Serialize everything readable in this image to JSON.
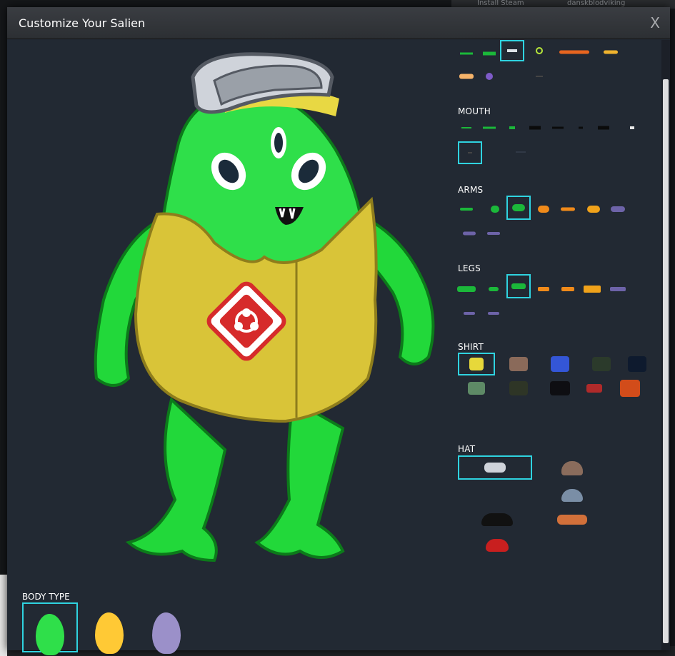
{
  "background": {
    "top_items": [
      "Install Steam",
      "danskblodviking"
    ],
    "bottom_items": [
      "...",
      "..."
    ]
  },
  "dialog": {
    "title": "Customize Your Salien",
    "close_label": "X"
  },
  "sections": {
    "mouth_label": "MOUTH",
    "arms_label": "ARMS",
    "legs_label": "LEGS",
    "shirt_label": "SHIRT",
    "hat_label": "HAT",
    "body_type_label": "BODY TYPE"
  },
  "colors": {
    "accent": "#2fd3e0",
    "panel_bg": "#222933",
    "body_green": "#2fdf4a",
    "body_yellow": "#ffc935",
    "body_purple": "#9b90c9",
    "suit_yellow": "#d9c438",
    "hazard_red": "#d62b2b"
  },
  "selected": {
    "eyes": "goggle-eye",
    "mouth": "small-mouth",
    "arms": "green-arm",
    "legs": "green-legs",
    "shirt": "hazmat-suit",
    "hat": "safety-goggles",
    "body_type": "green"
  }
}
